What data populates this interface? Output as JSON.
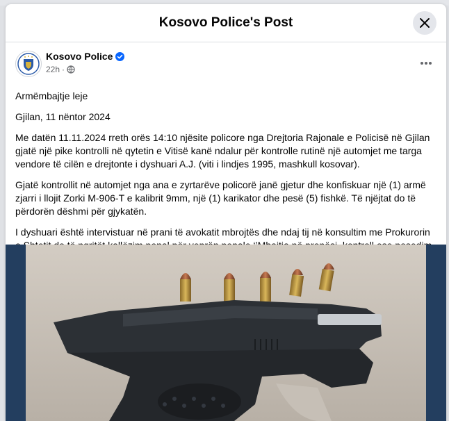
{
  "modal": {
    "title": "Kosovo Police's Post"
  },
  "post": {
    "page_name": "Kosovo Police",
    "verified_icon": "verified-badge-icon",
    "time": "22h",
    "separator": "·",
    "audience_icon": "globe-icon",
    "paragraphs": [
      "Armëmbajtje leje",
      "Gjilan, 11 nëntor 2024",
      "Me datën 11.11.2024 rreth orës 14:10 njësite policore nga Drejtoria Rajonale e Policisë në Gjilan gjatë një pike kontrolli në qytetin e Vitisë kanë ndalur për kontrolle rutinë një automjet me targa vendore të cilën e drejtonte i dyshuari A.J. (viti i lindjes 1995, mashkull kosovar).",
      "Gjatë kontrollit në automjet nga ana e zyrtarëve policorë janë gjetur dhe konfiskuar një (1) armë zjarri i llojit Zorki M-906-T e kalibrit 9mm, një (1) karikator dhe pesë (5) fishkë. Të njëjtat do të përdorën dëshmi për gjykatën.",
      "I dyshuari është intervistuar në prani të avokatit mbrojtës dhe ndaj tij në konsultim me Prokurorin e Shtetit do të ngritët kallëzim penal për veprën penale ‘’Mbajtja në pronësi, kontroll ose posedim të paautorizuar të armëve’’."
    ]
  },
  "colors": {
    "verified": "#0866ff",
    "photo_border": "#233e5f"
  }
}
